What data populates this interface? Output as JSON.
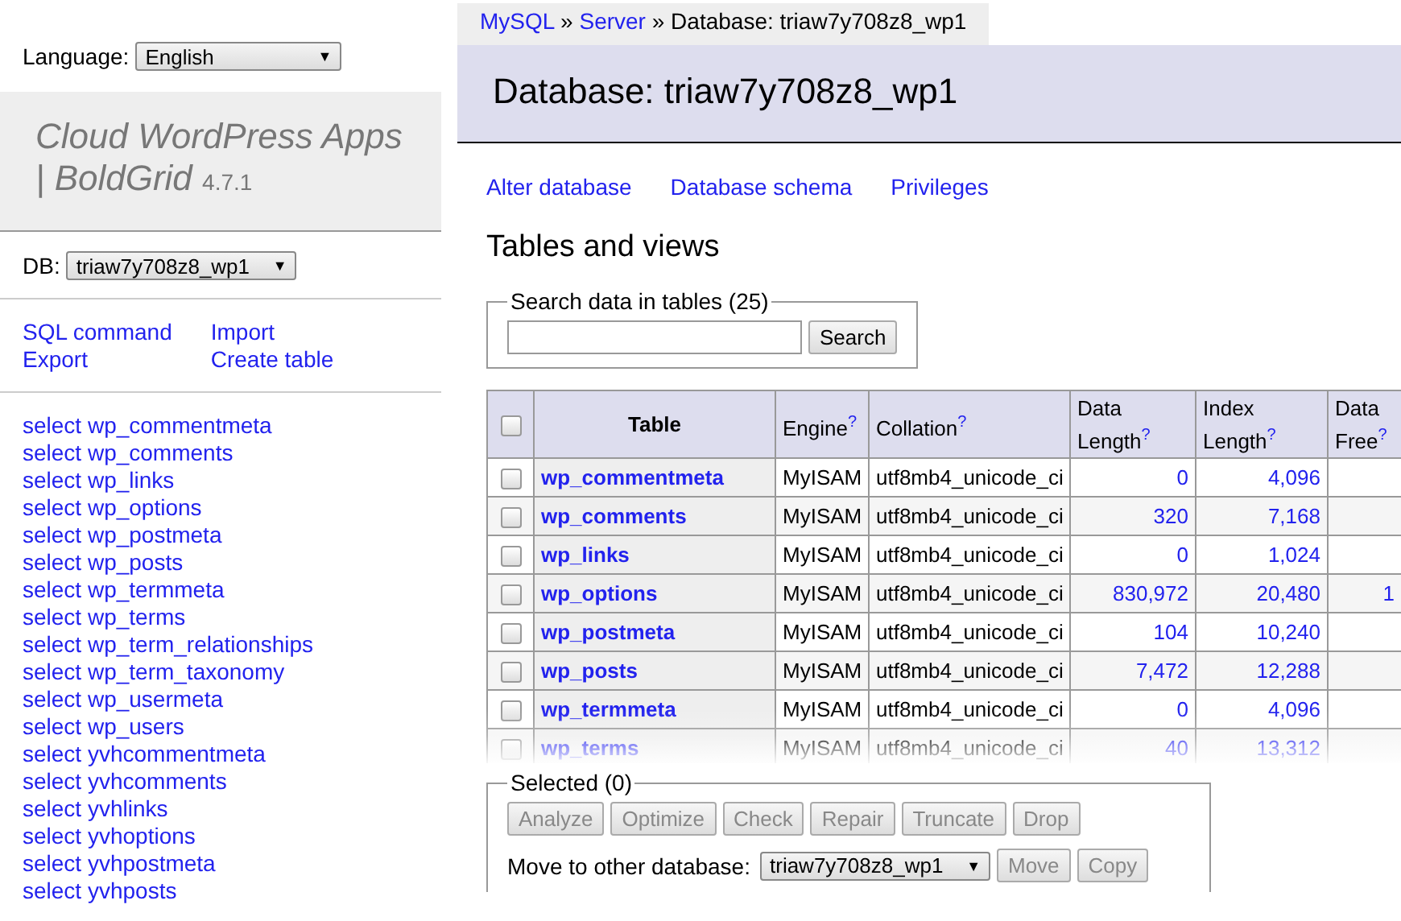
{
  "language": {
    "label": "Language:",
    "value": "English",
    "caret": "▼"
  },
  "app": {
    "title": "Cloud WordPress Apps | BoldGrid",
    "version": "4.7.1"
  },
  "db": {
    "label": "DB:",
    "value": "triaw7y708z8_wp1",
    "caret": "▼"
  },
  "sidebar_links": [
    "SQL command",
    "Import",
    "Export",
    "Create table"
  ],
  "table_links": [
    "select wp_commentmeta",
    "select wp_comments",
    "select wp_links",
    "select wp_options",
    "select wp_postmeta",
    "select wp_posts",
    "select wp_termmeta",
    "select wp_terms",
    "select wp_term_relationships",
    "select wp_term_taxonomy",
    "select wp_usermeta",
    "select wp_users",
    "select yvhcommentmeta",
    "select yvhcomments",
    "select yvhlinks",
    "select yvhoptions",
    "select yvhpostmeta",
    "select yvhposts"
  ],
  "breadcrumb": {
    "links": [
      "MySQL",
      "Server"
    ],
    "separator": "»",
    "current": "Database: triaw7y708z8_wp1"
  },
  "heading": "Database: triaw7y708z8_wp1",
  "actions": [
    "Alter database",
    "Database schema",
    "Privileges"
  ],
  "section_title": "Tables and views",
  "search": {
    "legend": "Search data in tables (25)",
    "button": "Search"
  },
  "table": {
    "select_all_checked": false,
    "columns": [
      {
        "label": "Table",
        "help": false
      },
      {
        "label": "Engine",
        "help": true
      },
      {
        "label": "Collation",
        "help": true
      },
      {
        "label": "Data Length",
        "help": true
      },
      {
        "label": "Index Length",
        "help": true
      },
      {
        "label": "Data Free",
        "help": true
      }
    ],
    "help_mark": "?",
    "rows": [
      {
        "checked": false,
        "name": "wp_commentmeta",
        "engine": "MyISAM",
        "collation": "utf8mb4_unicode_ci",
        "data_length": "0",
        "index_length": "4,096",
        "data_free": ""
      },
      {
        "checked": false,
        "name": "wp_comments",
        "engine": "MyISAM",
        "collation": "utf8mb4_unicode_ci",
        "data_length": "320",
        "index_length": "7,168",
        "data_free": ""
      },
      {
        "checked": false,
        "name": "wp_links",
        "engine": "MyISAM",
        "collation": "utf8mb4_unicode_ci",
        "data_length": "0",
        "index_length": "1,024",
        "data_free": ""
      },
      {
        "checked": false,
        "name": "wp_options",
        "engine": "MyISAM",
        "collation": "utf8mb4_unicode_ci",
        "data_length": "830,972",
        "index_length": "20,480",
        "data_free": "1"
      },
      {
        "checked": false,
        "name": "wp_postmeta",
        "engine": "MyISAM",
        "collation": "utf8mb4_unicode_ci",
        "data_length": "104",
        "index_length": "10,240",
        "data_free": ""
      },
      {
        "checked": false,
        "name": "wp_posts",
        "engine": "MyISAM",
        "collation": "utf8mb4_unicode_ci",
        "data_length": "7,472",
        "index_length": "12,288",
        "data_free": ""
      },
      {
        "checked": false,
        "name": "wp_termmeta",
        "engine": "MyISAM",
        "collation": "utf8mb4_unicode_ci",
        "data_length": "0",
        "index_length": "4,096",
        "data_free": ""
      },
      {
        "checked": false,
        "name": "wp_terms",
        "engine": "MyISAM",
        "collation": "utf8mb4_unicode_ci",
        "data_length": "40",
        "index_length": "13,312",
        "data_free": ""
      }
    ]
  },
  "selected": {
    "legend": "Selected (0)",
    "buttons": [
      {
        "label": "Analyze",
        "disabled": true
      },
      {
        "label": "Optimize",
        "disabled": true
      },
      {
        "label": "Check",
        "disabled": true
      },
      {
        "label": "Repair",
        "disabled": true
      },
      {
        "label": "Truncate",
        "disabled": true
      },
      {
        "label": "Drop",
        "disabled": true
      }
    ],
    "move_label": "Move to other database:",
    "move_value": "triaw7y708z8_wp1",
    "move_caret": "▼",
    "move_buttons": [
      {
        "label": "Move",
        "disabled": true
      },
      {
        "label": "Copy",
        "disabled": true
      }
    ]
  }
}
